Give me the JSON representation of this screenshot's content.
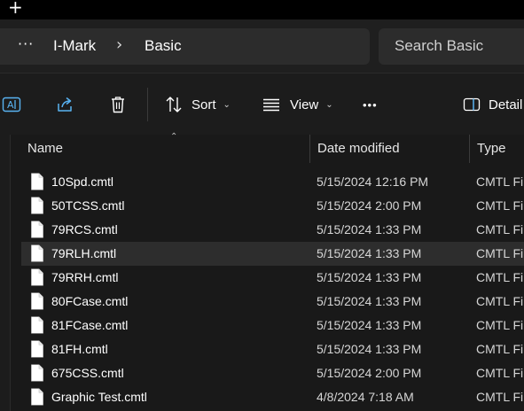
{
  "titlebar": {
    "new_tab_glyph": "+"
  },
  "breadcrumb": {
    "overflow_glyph": "···",
    "items": [
      "I-Mark",
      "Basic"
    ],
    "separator": "›"
  },
  "search": {
    "placeholder": "Search Basic"
  },
  "toolbar": {
    "icons": [
      "rename-icon",
      "share-icon",
      "delete-icon",
      "sort-icon",
      "view-icon",
      "more-icon",
      "details-pane-icon"
    ],
    "sort_label": "Sort",
    "view_label": "View",
    "more_glyph": "•••",
    "details_label": "Detail"
  },
  "columns": {
    "name": "Name",
    "date": "Date modified",
    "type": "Type"
  },
  "files": [
    {
      "name": "10Spd.cmtl",
      "date": "5/15/2024 12:16 PM",
      "type": "CMTL File"
    },
    {
      "name": "50TCSS.cmtl",
      "date": "5/15/2024 2:00 PM",
      "type": "CMTL File"
    },
    {
      "name": "79RCS.cmtl",
      "date": "5/15/2024 1:33 PM",
      "type": "CMTL File"
    },
    {
      "name": "79RLH.cmtl",
      "date": "5/15/2024 1:33 PM",
      "type": "CMTL File"
    },
    {
      "name": "79RRH.cmtl",
      "date": "5/15/2024 1:33 PM",
      "type": "CMTL File"
    },
    {
      "name": "80FCase.cmtl",
      "date": "5/15/2024 1:33 PM",
      "type": "CMTL File"
    },
    {
      "name": "81FCase.cmtl",
      "date": "5/15/2024 1:33 PM",
      "type": "CMTL File"
    },
    {
      "name": "81FH.cmtl",
      "date": "5/15/2024 1:33 PM",
      "type": "CMTL File"
    },
    {
      "name": "675CSS.cmtl",
      "date": "5/15/2024 2:00 PM",
      "type": "CMTL File"
    },
    {
      "name": "Graphic Test.cmtl",
      "date": "4/8/2024 7:18 AM",
      "type": "CMTL File"
    }
  ],
  "hovered_row": 3,
  "colors": {
    "background": "#191919",
    "hover": "#2d2d2d",
    "text": "#ffffff"
  }
}
